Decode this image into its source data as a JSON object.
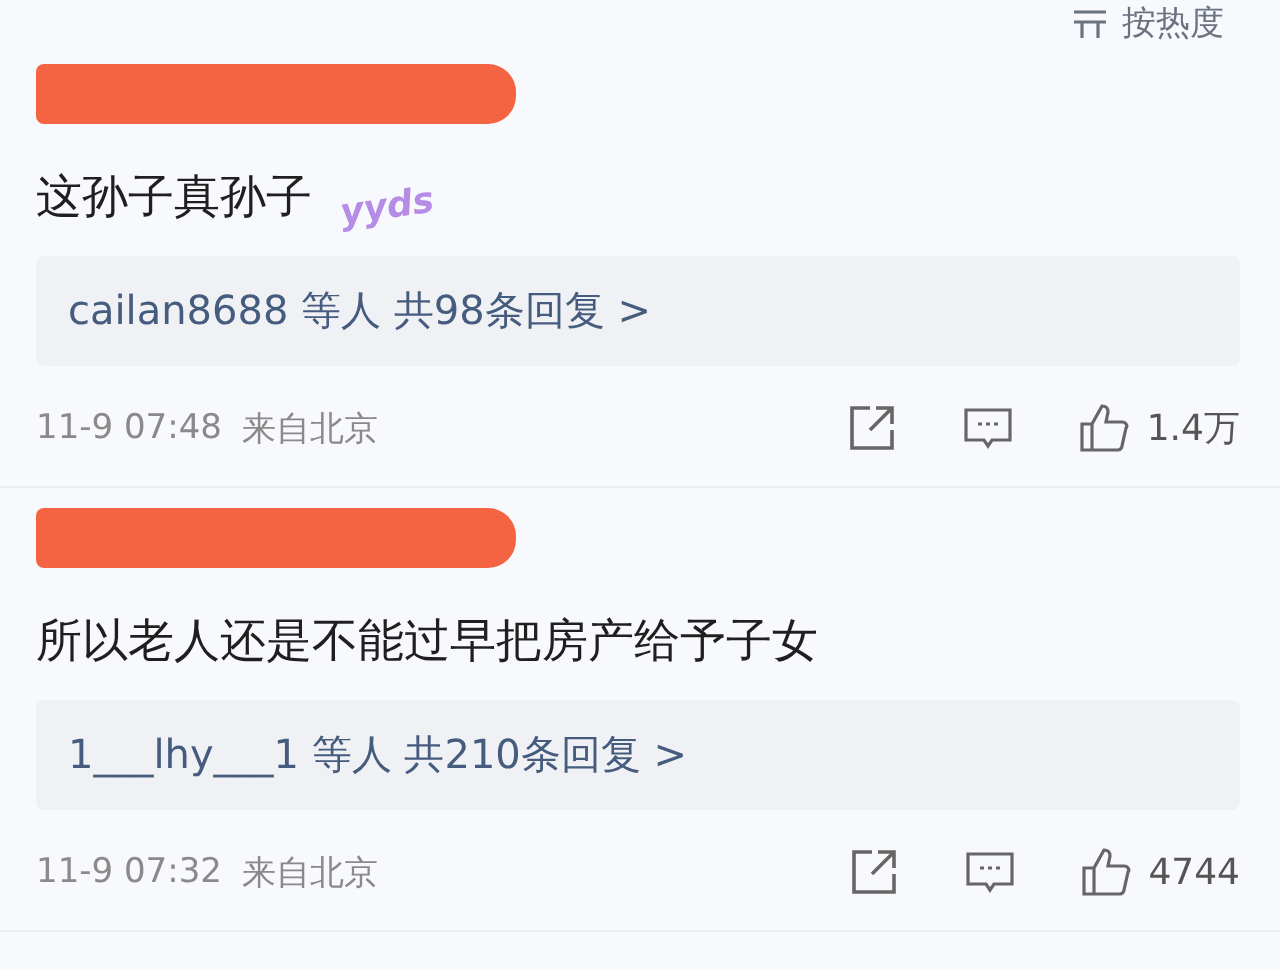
{
  "sort": {
    "label": "按热度"
  },
  "comments": [
    {
      "text": "这孙子真孙子",
      "sticker": "yyds",
      "replies": "cailan8688 等人 共98条回复 >",
      "time": "11-9 07:48",
      "location": "来自北京",
      "likes": "1.4万"
    },
    {
      "text": "所以老人还是不能过早把房产给予子女",
      "replies": "1___lhy___1 等人 共210条回复 >",
      "time": "11-9 07:32",
      "location": "来自北京",
      "likes": "4744"
    }
  ]
}
